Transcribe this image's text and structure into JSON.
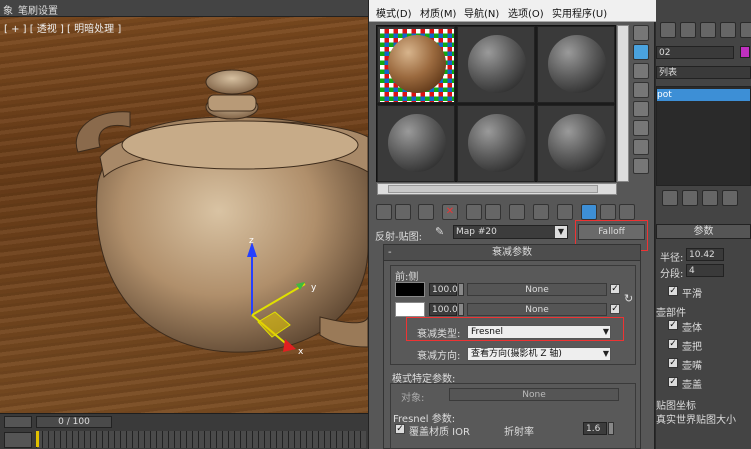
{
  "top_menu": {
    "item1": "象",
    "item2": "笔刷设置"
  },
  "viewport": {
    "label": "[ + ] [ 透视 ] [ 明暗处理 ]"
  },
  "timeline": {
    "frame_display": "0 / 100",
    "tick_labels": [
      "0",
      "5",
      "10",
      "15",
      "20",
      "25",
      "30",
      "35",
      "40",
      "45",
      "50",
      "55",
      "60"
    ]
  },
  "material_editor": {
    "menu": [
      "模式(D)",
      "材质(M)",
      "导航(N)",
      "选项(O)",
      "实用程序(U)"
    ],
    "reflection_label": "反射-贴图:",
    "map_name": "Map #20",
    "map_type_button": "Falloff",
    "rollout_title": "衰减参数",
    "front_side_label": "前:侧",
    "color1": {
      "amount": "100.0",
      "map": "None"
    },
    "color2": {
      "amount": "100.0",
      "map": "None"
    },
    "falloff_type_label": "衰减类型:",
    "falloff_type_value": "Fresnel",
    "falloff_direction_label": "衰减方向:",
    "falloff_direction_value": "查看方向(摄影机 Z 轴)",
    "mode_params_label": "模式特定参数:",
    "object_label": "对象:",
    "object_value": "None",
    "fresnel_params_label": "Fresnel 参数:",
    "override_ior_label": "覆盖材质 IOR",
    "ior_label": "折射率",
    "ior_value": "1.6"
  },
  "command_panel": {
    "name_field": "02",
    "list_label": "列表",
    "modifier": "pot",
    "params_header": "参数",
    "radius_label": "半径:",
    "radius_value": "10.42",
    "segments_label": "分段:",
    "segments_value": "4",
    "smooth_label": "平滑",
    "parts_label": "壶部件",
    "parts": [
      "壶体",
      "壶把",
      "壶嘴",
      "壶盖"
    ],
    "mapping_label": "贴图坐标",
    "realworld_label": "真实世界贴图大小"
  },
  "colors": {
    "highlight_red": "#e33333",
    "active_blue": "#3d8fd6",
    "modifier_blue": "#3d8fd6"
  }
}
